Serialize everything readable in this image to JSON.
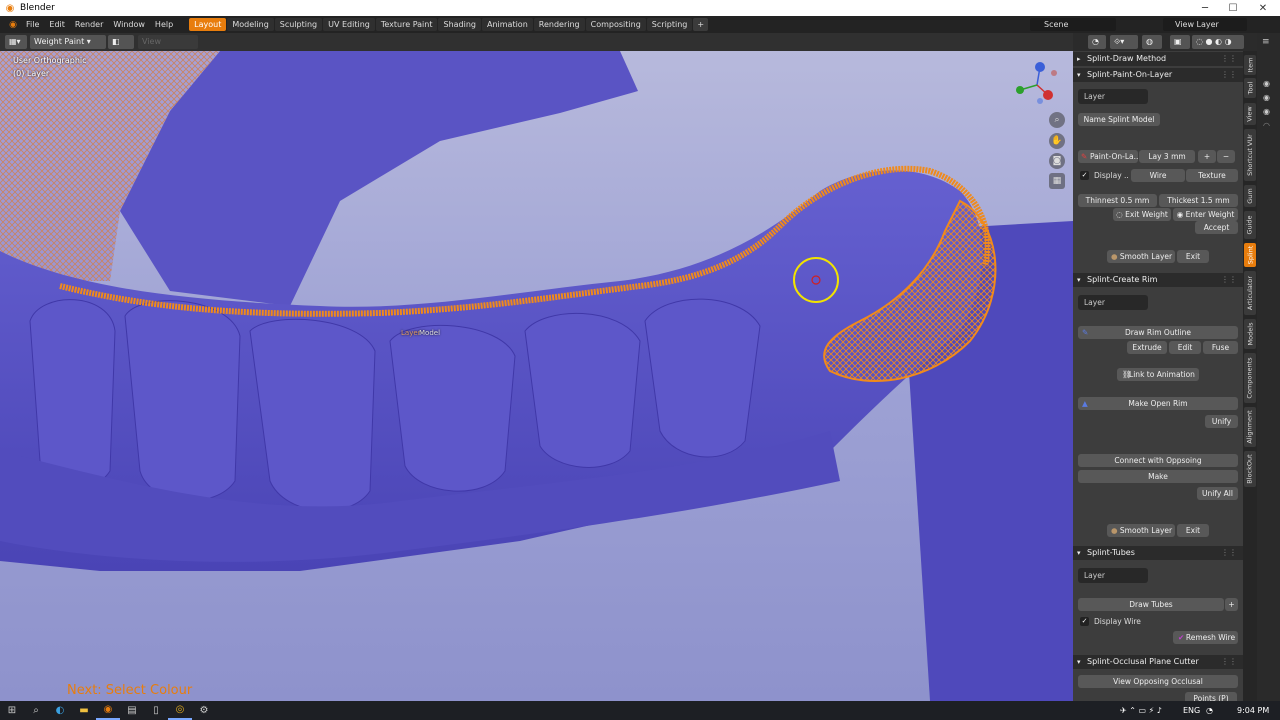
{
  "window": {
    "title": "Blender",
    "controls": {
      "minimize": "─",
      "maximize": "☐",
      "close": "✕"
    }
  },
  "menubar": {
    "menus": [
      "File",
      "Edit",
      "Render",
      "Window",
      "Help"
    ],
    "workspaces": [
      "Layout",
      "Modeling",
      "Sculpting",
      "UV Editing",
      "Texture Paint",
      "Shading",
      "Animation",
      "Rendering",
      "Compositing",
      "Scripting"
    ],
    "active_workspace": "Layout",
    "add_tab": "+",
    "scene": "Scene",
    "view_layer": "View Layer"
  },
  "viewport_header": {
    "mode": "Weight Paint",
    "extra": "View  Weights"
  },
  "viewport": {
    "view_name": "User Orthographic",
    "collection": "(0) Layer",
    "object_label_a": "Layer",
    "object_label_b": "Model",
    "hint": "Next: Select Colour",
    "gizmo_axes": [
      "X",
      "Y",
      "Z"
    ]
  },
  "npanel": {
    "draw_method": {
      "title": "Splint-Draw Method"
    },
    "paint_on_layer": {
      "title": "Splint-Paint-On-Layer",
      "layer_field": "Layer",
      "name_button": "Name Splint Model",
      "paint_button": "Paint-On-La..",
      "lay_value": "Lay  3 mm",
      "plus": "+",
      "minus": "−",
      "display_label": "Display ..",
      "wire_button": "Wire",
      "texture_button": "Texture",
      "thinnest": "Thinnest  0.5 mm",
      "thickest": "Thickest  1.5 mm",
      "exit_weight": "Exit Weight",
      "enter_weight": "Enter Weight",
      "accept": "Accept",
      "smooth_layer": "Smooth Layer",
      "exit": "Exit"
    },
    "create_rim": {
      "title": "Splint-Create Rim",
      "layer_field": "Layer",
      "draw_outline": "Draw Rim Outline",
      "extrude": "Extrude",
      "edit": "Edit",
      "fuse": "Fuse",
      "link_animation": "Link to Animation",
      "make_open_rim": "Make  Open Rim",
      "unify": "Unify",
      "connect_opposing": "Connect with Oppsoing",
      "make": "Make",
      "unify_all": "Unify All",
      "smooth_layer": "Smooth Layer",
      "exit": "Exit"
    },
    "tubes": {
      "title": "Splint-Tubes",
      "layer_field": "Layer",
      "draw_tubes": "Draw Tubes",
      "plus": "+",
      "display_wire": "Display Wire",
      "remesh_wire": "Remesh Wire"
    },
    "occlusal": {
      "title": "Splint-Occlusal Plane Cutter",
      "view_opposing": "View Opposing Occlusal",
      "points": "Points (P)"
    }
  },
  "vertical_tabs": [
    {
      "label": "Item",
      "active": false
    },
    {
      "label": "Tool",
      "active": false
    },
    {
      "label": "View",
      "active": false
    },
    {
      "label": "Shortcut VUr",
      "active": false
    },
    {
      "label": "Gum",
      "active": false
    },
    {
      "label": "Guide",
      "active": false
    },
    {
      "label": "Splint",
      "active": true
    },
    {
      "label": "Articulator",
      "active": false
    },
    {
      "label": "Models",
      "active": false
    },
    {
      "label": "Components",
      "active": false
    },
    {
      "label": "Alignment",
      "active": false
    },
    {
      "label": "BlockOut",
      "active": false
    }
  ],
  "taskbar": {
    "lang": "ENG",
    "time": "9:04 PM"
  },
  "colors": {
    "accent": "#e87d0d",
    "mesh": "#5b55c7",
    "wire": "#f08a1c"
  }
}
